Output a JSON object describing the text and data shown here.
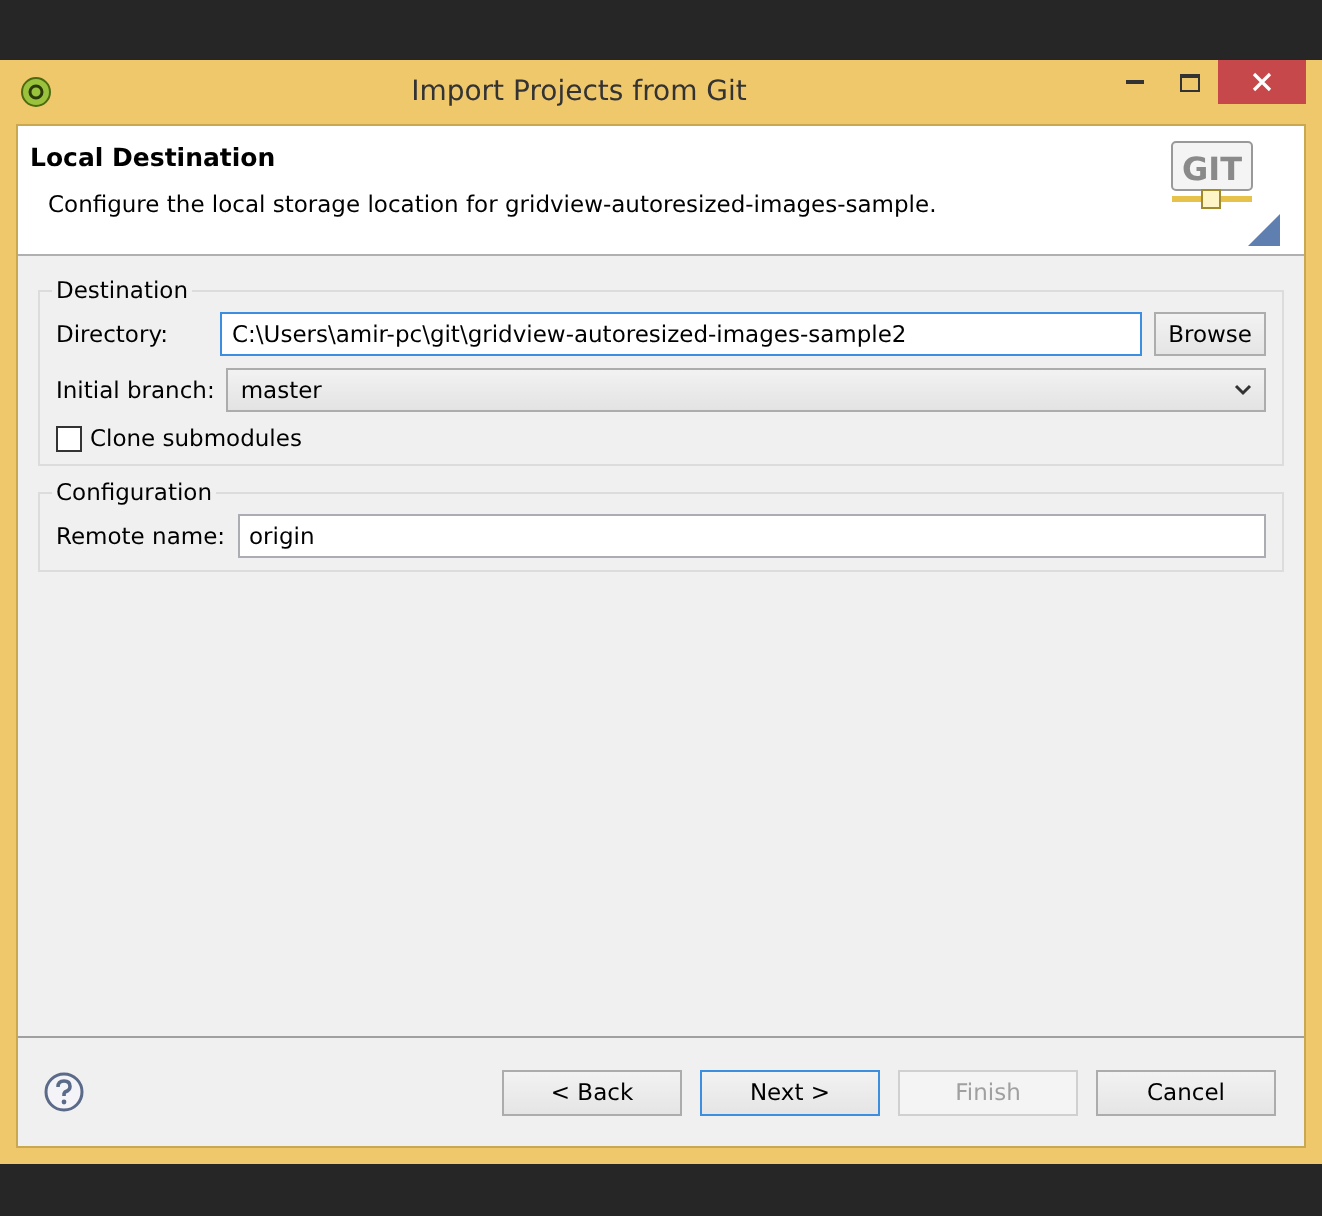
{
  "window": {
    "title": "Import Projects from Git"
  },
  "header": {
    "logo_text": "GIT",
    "title": "Local Destination",
    "description": "Configure the local storage location for gridview-autoresized-images-sample."
  },
  "destination": {
    "legend": "Destination",
    "directory": {
      "label": "Directory:",
      "value": "C:\\Users\\amir-pc\\git\\gridview-autoresized-images-sample2",
      "focused": true
    },
    "browse": "Browse",
    "branch": {
      "label": "Initial branch:",
      "value": "master"
    },
    "clone_submodules": {
      "label": "Clone submodules",
      "checked": false
    }
  },
  "configuration": {
    "legend": "Configuration",
    "remote": {
      "label": "Remote name:",
      "value": "origin"
    }
  },
  "buttons": [
    {
      "label": "< Back",
      "disabled": false,
      "default": false
    },
    {
      "label": "Next >",
      "disabled": false,
      "default": true
    },
    {
      "label": "Finish",
      "disabled": true,
      "default": false
    },
    {
      "label": "Cancel",
      "disabled": false,
      "default": false
    }
  ]
}
